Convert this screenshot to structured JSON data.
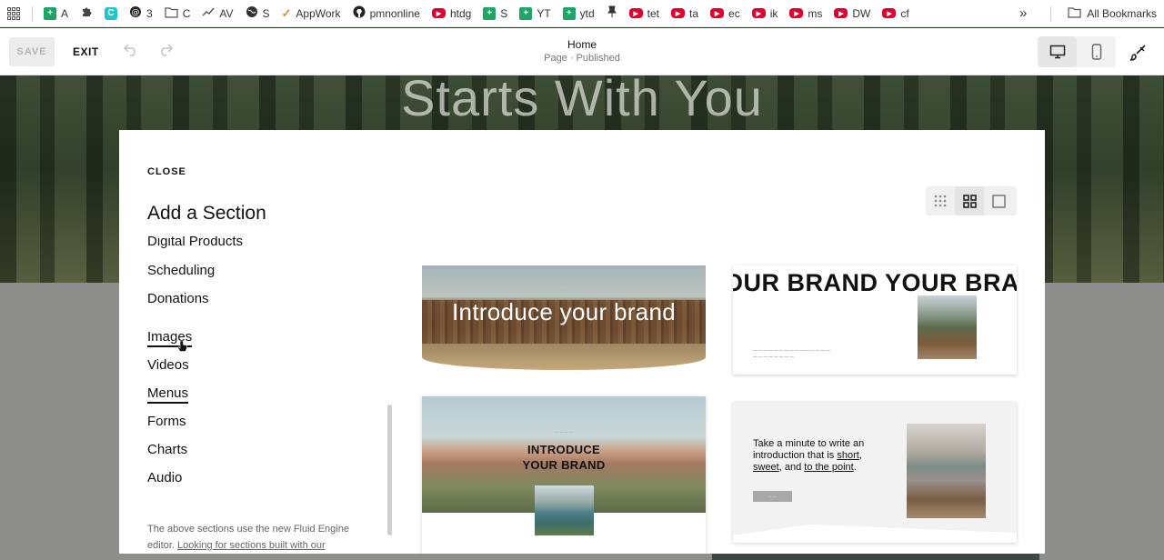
{
  "bookmarks": {
    "items": [
      {
        "label": "A",
        "icon": "sheets-icon"
      },
      {
        "label": "",
        "icon": "puzzle-icon"
      },
      {
        "label": "",
        "icon": "canva-icon"
      },
      {
        "label": "3",
        "icon": "threads-icon"
      },
      {
        "label": "C",
        "icon": "folder-icon"
      },
      {
        "label": "AV",
        "icon": "trend-icon"
      },
      {
        "label": "S",
        "icon": "globe-icon"
      },
      {
        "label": "AppWork",
        "icon": "check-icon"
      },
      {
        "label": "pmnonline",
        "icon": "github-icon"
      },
      {
        "label": "htdg",
        "icon": "youtube-icon"
      },
      {
        "label": "S",
        "icon": "sheets-icon"
      },
      {
        "label": "YT",
        "icon": "sheets-icon"
      },
      {
        "label": "ytd",
        "icon": "sheets-icon"
      },
      {
        "label": "",
        "icon": "pin-icon"
      },
      {
        "label": "tet",
        "icon": "youtube-icon"
      },
      {
        "label": "ta",
        "icon": "youtube-icon"
      },
      {
        "label": "ec",
        "icon": "youtube-icon"
      },
      {
        "label": "ik",
        "icon": "youtube-icon"
      },
      {
        "label": "ms",
        "icon": "youtube-icon"
      },
      {
        "label": "DW",
        "icon": "youtube-icon"
      },
      {
        "label": "cf",
        "icon": "youtube-icon"
      }
    ],
    "overflow": "»",
    "all_bookmarks": "All Bookmarks"
  },
  "toolbar": {
    "save_label": "SAVE",
    "exit_label": "EXIT",
    "page_title": "Home",
    "page_status": "Page · Published"
  },
  "hero": {
    "title": "Starts With You"
  },
  "modal": {
    "close_label": "CLOSE",
    "title": "Add a Section",
    "categories": [
      {
        "label": "Digital Products"
      },
      {
        "label": "Scheduling"
      },
      {
        "label": "Donations"
      },
      {
        "label": "Images"
      },
      {
        "label": "Videos"
      },
      {
        "label": "Menus"
      },
      {
        "label": "Forms"
      },
      {
        "label": "Charts"
      },
      {
        "label": "Audio"
      }
    ],
    "footnote": "The above sections use the new Fluid Engine editor.",
    "footnote_link": "Looking for sections built with our",
    "thumbnails": {
      "t1_text": "Introduce your brand",
      "t2_text": "OUR BRAND  YOUR BRAN",
      "t3_text": "INTRODUCE YOUR BRAND",
      "t4_text_a": "Take a minute to write an introduction that is ",
      "t4_text_short": "short",
      "t4_text_b": ", ",
      "t4_text_sweet": "sweet",
      "t4_text_c": ", and ",
      "t4_text_point": "to the point",
      "t4_text_d": "."
    }
  },
  "colors": {
    "sheets_green": "#1fa463",
    "youtube_red": "#e1002d",
    "modal_bg": "#ffffff",
    "backdrop_gray": "#8e8f8d"
  }
}
